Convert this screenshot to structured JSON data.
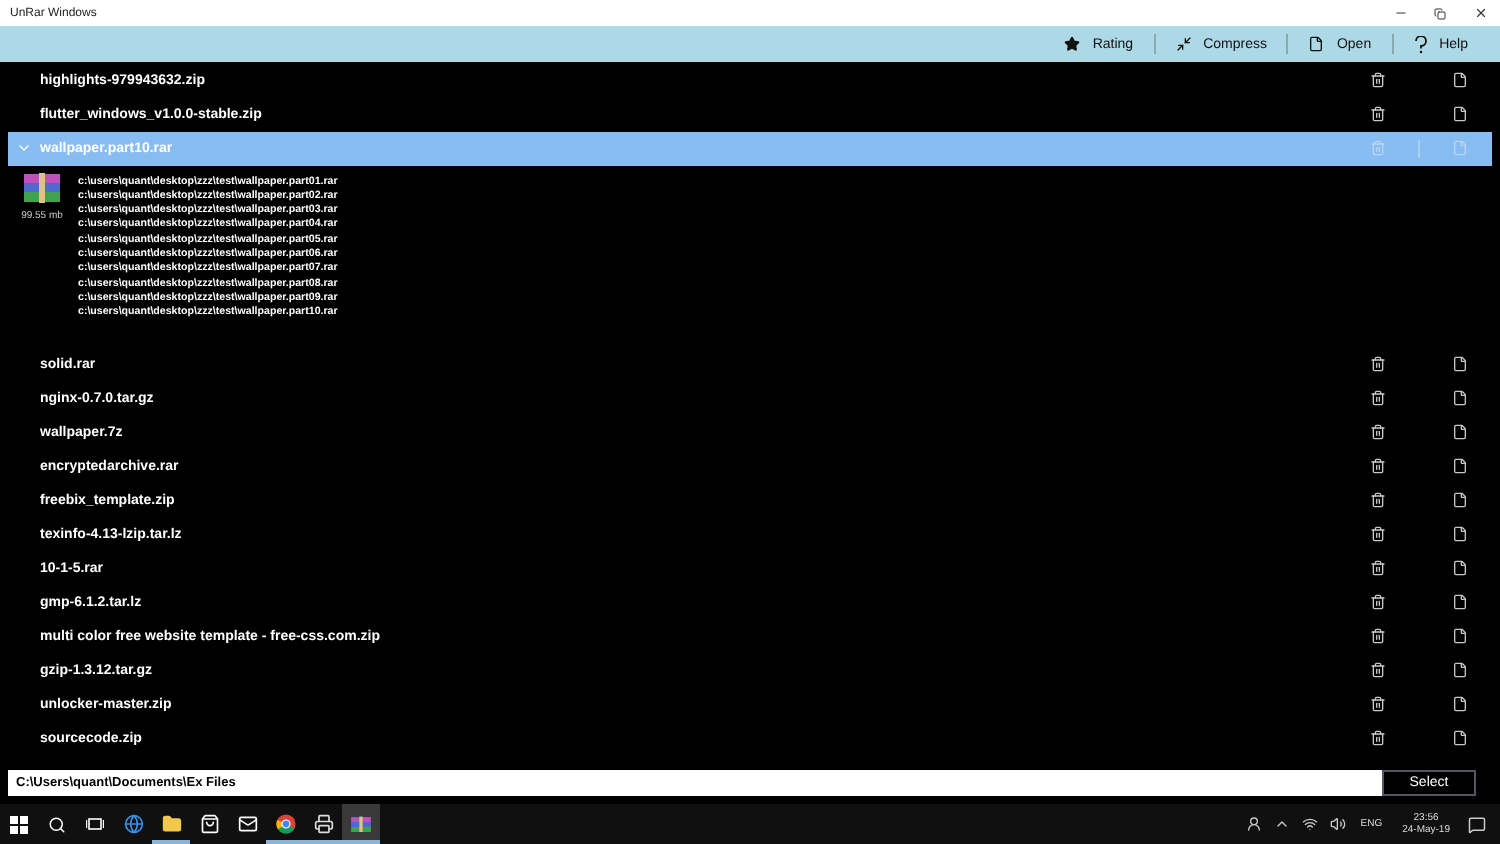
{
  "window": {
    "title": "UnRar Windows"
  },
  "toolbar": [
    {
      "kind": "rating",
      "label": "Rating"
    },
    {
      "kind": "compress",
      "label": "Compress"
    },
    {
      "kind": "open",
      "label": "Open"
    },
    {
      "kind": "help",
      "label": "Help"
    }
  ],
  "files": [
    {
      "name": "highlights-979943632.zip",
      "selected": false,
      "expanded": false
    },
    {
      "name": "flutter_windows_v1.0.0-stable.zip",
      "selected": false,
      "expanded": false
    },
    {
      "name": "wallpaper.part10.rar",
      "selected": true,
      "expanded": true,
      "details": {
        "size": "99.55 mb",
        "parts": [
          "c:\\users\\quant\\desktop\\zzz\\test\\wallpaper.part01.rar",
          "c:\\users\\quant\\desktop\\zzz\\test\\wallpaper.part02.rar",
          "c:\\users\\quant\\desktop\\zzz\\test\\wallpaper.part03.rar",
          "c:\\users\\quant\\desktop\\zzz\\test\\wallpaper.part04.rar",
          "c:\\users\\quant\\desktop\\zzz\\test\\wallpaper.part05.rar",
          "c:\\users\\quant\\desktop\\zzz\\test\\wallpaper.part06.rar",
          "c:\\users\\quant\\desktop\\zzz\\test\\wallpaper.part07.rar",
          "c:\\users\\quant\\desktop\\zzz\\test\\wallpaper.part08.rar",
          "c:\\users\\quant\\desktop\\zzz\\test\\wallpaper.part09.rar",
          "c:\\users\\quant\\desktop\\zzz\\test\\wallpaper.part10.rar"
        ]
      }
    },
    {
      "name": "solid.rar",
      "selected": false,
      "expanded": false
    },
    {
      "name": "nginx-0.7.0.tar.gz",
      "selected": false,
      "expanded": false
    },
    {
      "name": "wallpaper.7z",
      "selected": false,
      "expanded": false
    },
    {
      "name": "encryptedarchive.rar",
      "selected": false,
      "expanded": false
    },
    {
      "name": "freebix_template.zip",
      "selected": false,
      "expanded": false
    },
    {
      "name": "texinfo-4.13-lzip.tar.lz",
      "selected": false,
      "expanded": false
    },
    {
      "name": "10-1-5.rar",
      "selected": false,
      "expanded": false
    },
    {
      "name": "gmp-6.1.2.tar.lz",
      "selected": false,
      "expanded": false
    },
    {
      "name": "multi color free website template - free-css.com.zip",
      "selected": false,
      "expanded": false
    },
    {
      "name": "gzip-1.3.12.tar.gz",
      "selected": false,
      "expanded": false
    },
    {
      "name": "unlocker-master.zip",
      "selected": false,
      "expanded": false
    },
    {
      "name": "sourcecode.zip",
      "selected": false,
      "expanded": false
    }
  ],
  "path_bar": {
    "value": "C:\\Users\\quant\\Documents\\Ex Files",
    "button": "Select"
  },
  "taskbar": {
    "apps": [
      {
        "kind": "browser-e",
        "running": false,
        "selected": false
      },
      {
        "kind": "folder",
        "running": true,
        "selected": false
      },
      {
        "kind": "store",
        "running": false,
        "selected": false
      },
      {
        "kind": "mail",
        "running": false,
        "selected": false
      },
      {
        "kind": "round-browser",
        "running": true,
        "selected": false
      },
      {
        "kind": "device",
        "running": true,
        "selected": false
      },
      {
        "kind": "archive",
        "running": true,
        "selected": true
      }
    ],
    "language": "ENG",
    "time": "23:56",
    "date": "24-May-19"
  }
}
